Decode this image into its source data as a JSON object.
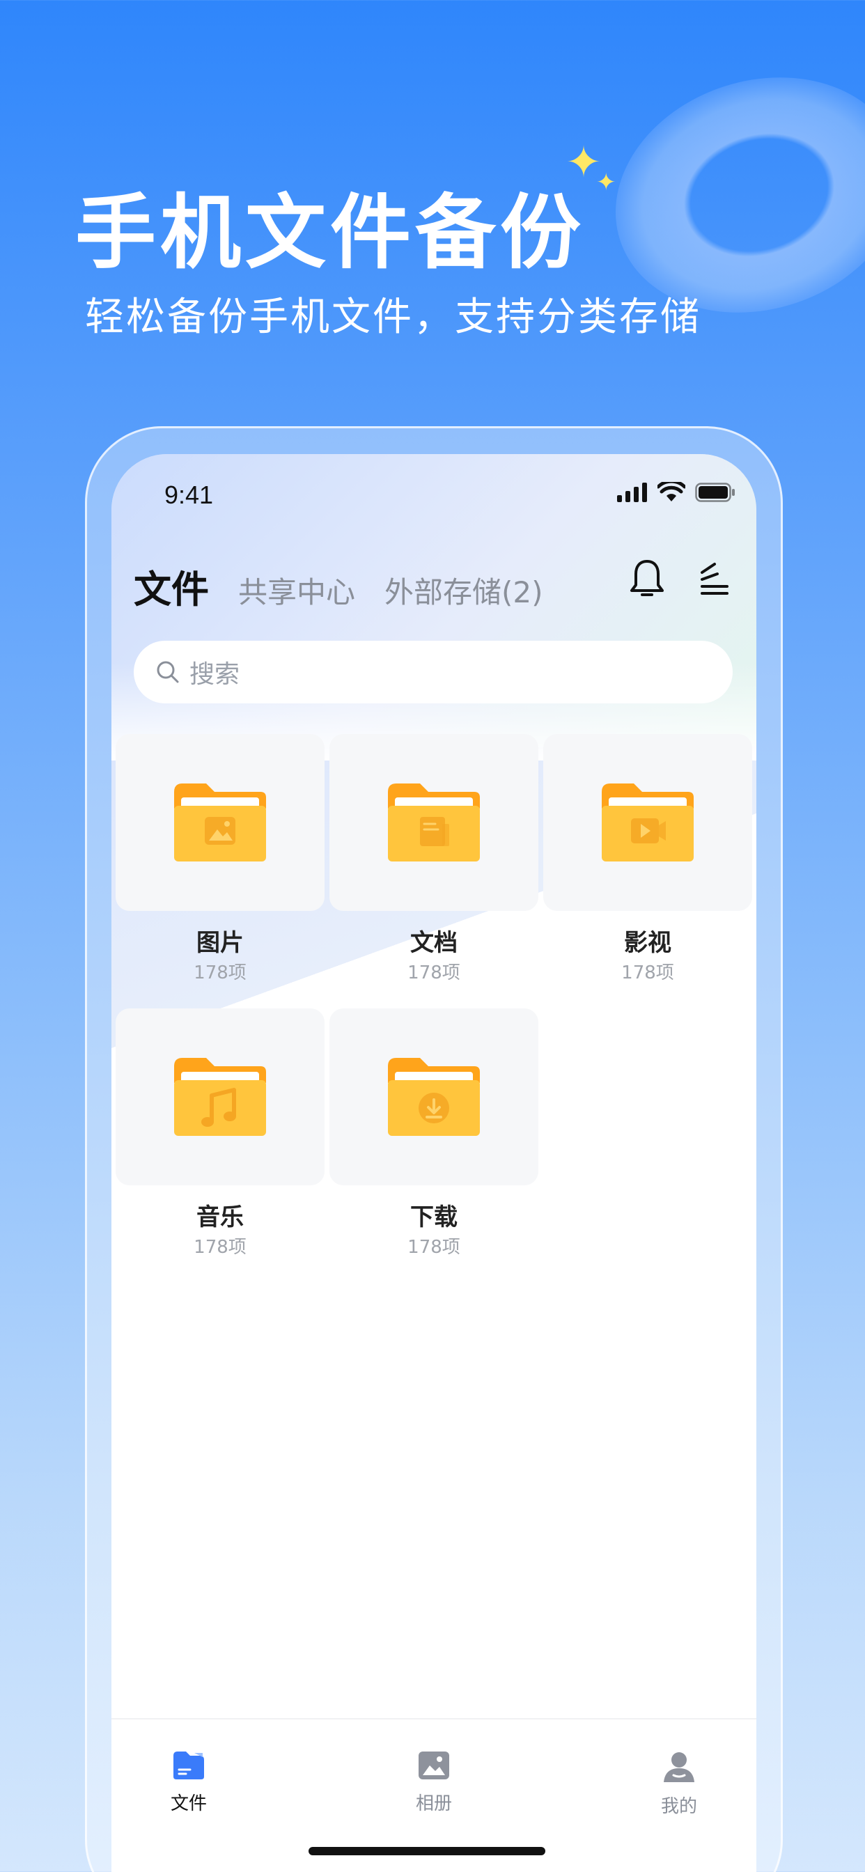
{
  "promo": {
    "title": "手机文件备份",
    "subtitle": "轻松备份手机文件，支持分类存储"
  },
  "status_bar": {
    "time": "9:41"
  },
  "tabs": {
    "active": "文件",
    "items": [
      "共享中心",
      "外部存储(2)"
    ]
  },
  "search": {
    "placeholder": "搜索"
  },
  "folders": [
    {
      "name": "图片",
      "count": "178项",
      "icon": "image"
    },
    {
      "name": "文档",
      "count": "178项",
      "icon": "document"
    },
    {
      "name": "影视",
      "count": "178项",
      "icon": "video"
    },
    {
      "name": "音乐",
      "count": "178项",
      "icon": "music"
    },
    {
      "name": "下载",
      "count": "178项",
      "icon": "download"
    }
  ],
  "bottom_nav": {
    "items": [
      {
        "label": "文件",
        "active": true
      },
      {
        "label": "相册",
        "active": false
      },
      {
        "label": "我的",
        "active": false
      }
    ]
  },
  "colors": {
    "accent": "#3a7bfa",
    "folder": "#ffc53d",
    "folder_tab": "#ffa41b"
  }
}
